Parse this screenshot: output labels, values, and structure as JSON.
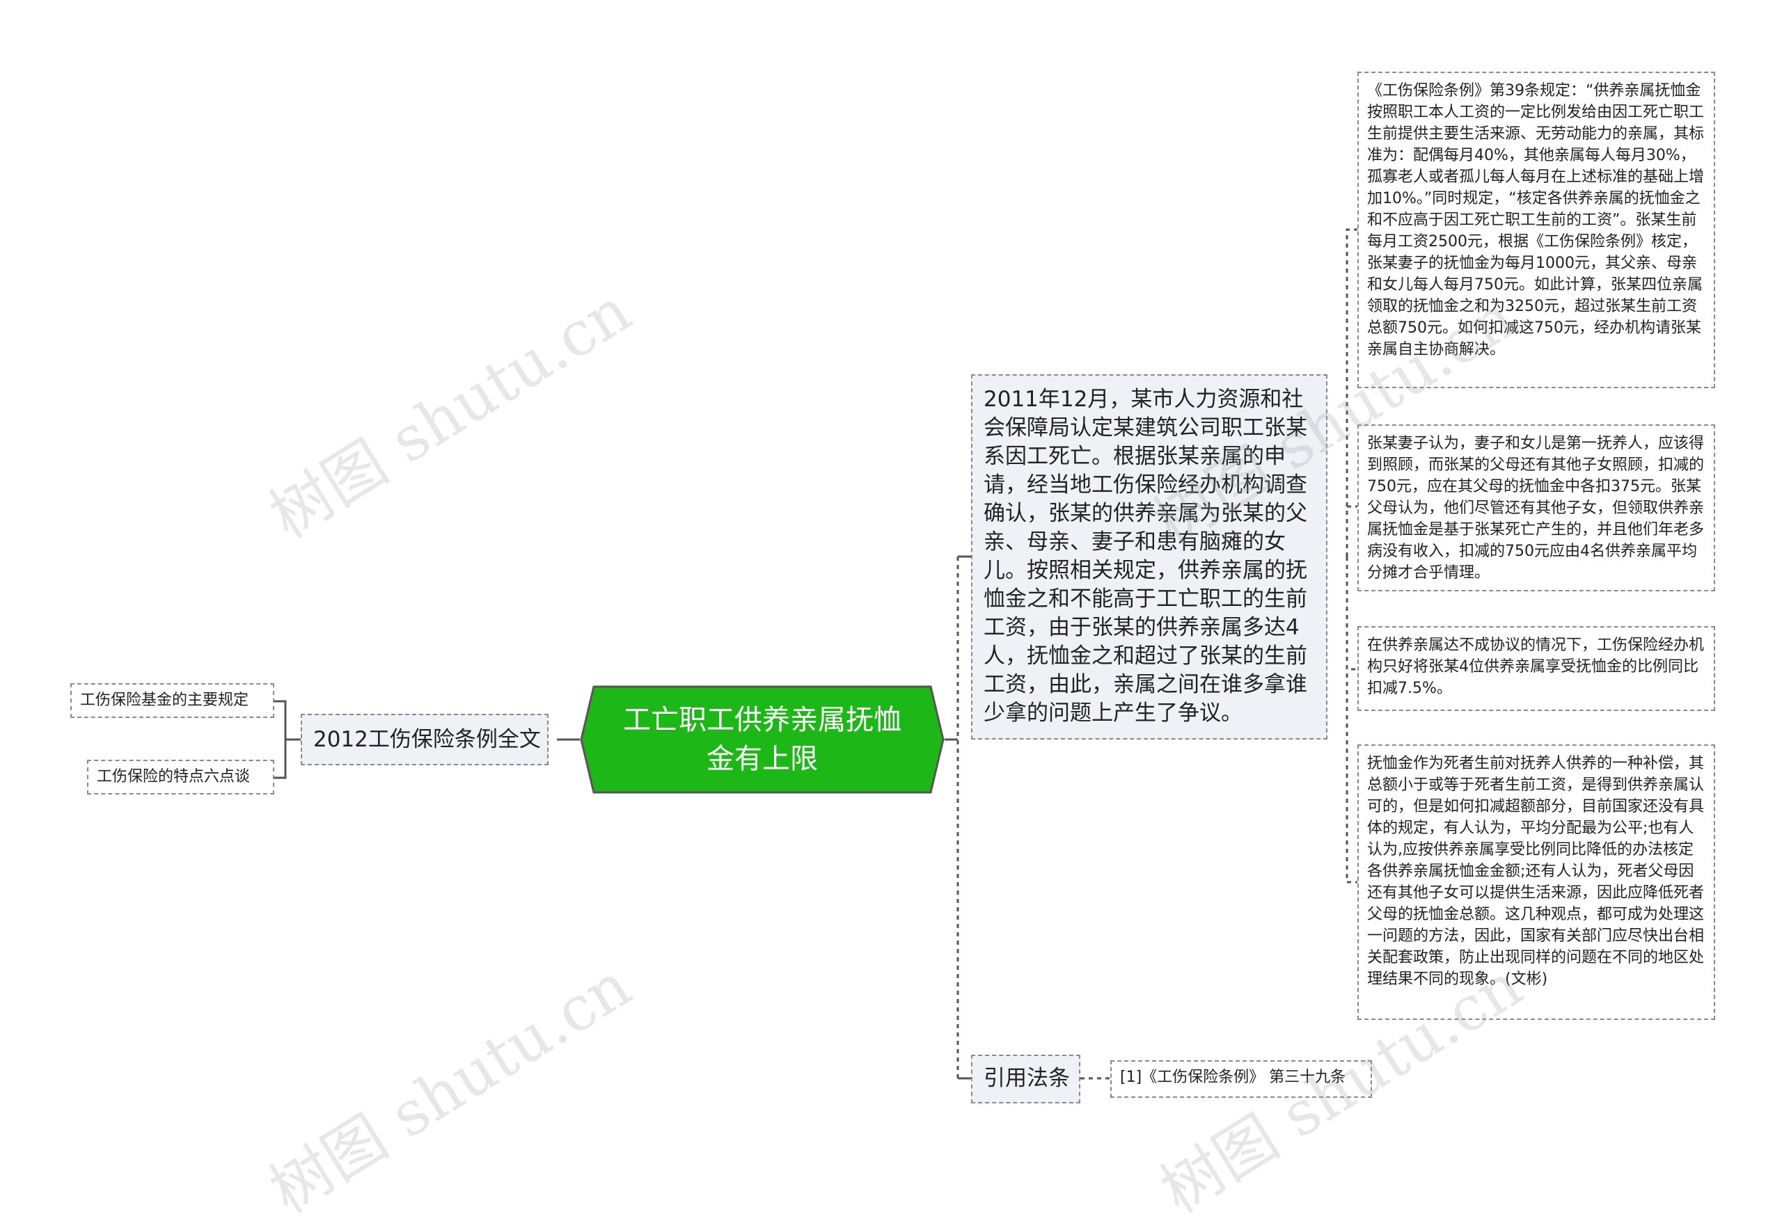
{
  "diagram": {
    "center": {
      "label": "工亡职工供养亲属抚恤金有上限",
      "fill": "#1db818",
      "border": "#666666"
    },
    "left_branch": {
      "label": "2012工伤保险条例全文",
      "children": [
        "工伤保险基金的主要规定",
        "工伤保险的特点六点谈"
      ]
    },
    "main_branch": {
      "text": "2011年12月，某市人力资源和社会保障局认定某建筑公司职工张某系因工死亡。根据张某亲属的申请，经当地工伤保险经办机构调查确认，张某的供养亲属为张某的父亲、母亲、妻子和患有脑瘫的女儿。按照相关规定，供养亲属的抚恤金之和不能高于工亡职工的生前工资，由于张某的供养亲属多达4人，抚恤金之和超过了张某的生前工资，由此，亲属之间在谁多拿谁少拿的问题上产生了争议。",
      "children": [
        "《工伤保险条例》第39条规定：“供养亲属抚恤金按照职工本人工资的一定比例发给由因工死亡职工生前提供主要生活来源、无劳动能力的亲属，其标准为：配偶每月40%，其他亲属每人每月30%，孤寡老人或者孤儿每人每月在上述标准的基础上增加10%。”同时规定，“核定各供养亲属的抚恤金之和不应高于因工死亡职工生前的工资”。张某生前每月工资2500元，根据《工伤保险条例》核定，张某妻子的抚恤金为每月1000元，其父亲、母亲和女儿每人每月750元。如此计算，张某四位亲属领取的抚恤金之和为3250元，超过张某生前工资总额750元。如何扣减这750元，经办机构请张某亲属自主协商解决。",
        "张某妻子认为，妻子和女儿是第一抚养人，应该得到照顾，而张某的父母还有其他子女照顾，扣减的750元，应在其父母的抚恤金中各扣375元。张某父母认为，他们尽管还有其他子女，但领取供养亲属抚恤金是基于张某死亡产生的，并且他们年老多病没有收入，扣减的750元应由4名供养亲属平均分摊才合乎情理。",
        "在供养亲属达不成协议的情况下，工伤保险经办机构只好将张某4位供养亲属享受抚恤金的比例同比扣减7.5%。",
        "抚恤金作为死者生前对抚养人供养的一种补偿，其总额小于或等于死者生前工资，是得到供养亲属认可的，但是如何扣减超额部分，目前国家还没有具体的规定，有人认为，平均分配最为公平;也有人认为,应按供养亲属享受比例同比降低的办法核定各供养亲属抚恤金金额;还有人认为，死者父母因还有其他子女可以提供生活来源，因此应降低死者父母的抚恤金总额。这几种观点，都可成为处理这一问题的方法，因此，国家有关部门应尽快出台相关配套政策，防止出现同样的问题在不同的地区处理结果不同的现象。(文彬)"
      ]
    },
    "law_branch": {
      "label": "引用法条",
      "children": [
        "[1]《工伤保险条例》 第三十九条"
      ]
    },
    "watermarks": [
      "树图 shutu.cn",
      "树图 shutu.cn",
      "树图 shutu.cn",
      "树图 shutu.cn"
    ]
  }
}
